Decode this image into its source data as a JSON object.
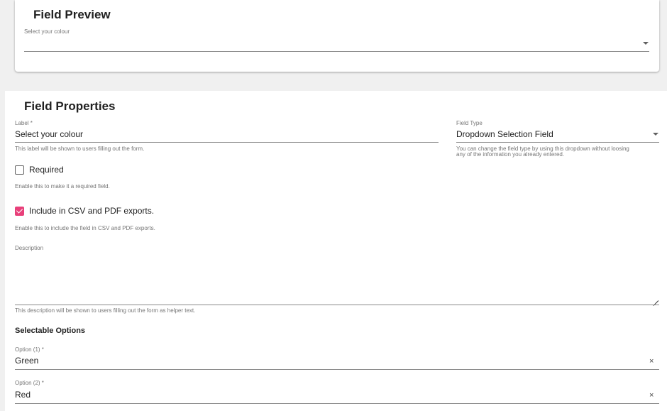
{
  "preview": {
    "title": "Field Preview",
    "select_label": "Select your colour",
    "select_value": ""
  },
  "properties": {
    "title": "Field Properties",
    "label_field": {
      "label": "Label *",
      "value": "Select your colour",
      "helper": "This label will be shown to users filling out the form."
    },
    "field_type": {
      "label": "Field Type",
      "value": "Dropdown Selection Field",
      "helper_line1": "You can change the field type by using this dropdown without loosing",
      "helper_line2": "any of the information you already entered."
    },
    "required": {
      "label": "Required",
      "checked": false,
      "helper": "Enable this to make it a required field."
    },
    "export": {
      "label": "Include in CSV and PDF exports.",
      "checked": true,
      "helper": "Enable this to include the field in CSV and PDF exports."
    },
    "description": {
      "label": "Description",
      "value": "",
      "helper": "This description will be shown to users filling out the form as helper text."
    },
    "options_heading": "Selectable Options",
    "options": [
      {
        "label": "Option (1) *",
        "value": "Green",
        "clear_icon": "×"
      },
      {
        "label": "Option (2) *",
        "value": "Red",
        "clear_icon": "×"
      }
    ]
  },
  "colors": {
    "accent": "#e8407a",
    "background": "#f0f0f0",
    "surface": "#ffffff"
  },
  "icons": [
    "chevron-down-icon",
    "checkbox-icon",
    "checkmark-icon",
    "resize-handle-icon",
    "close-icon"
  ]
}
